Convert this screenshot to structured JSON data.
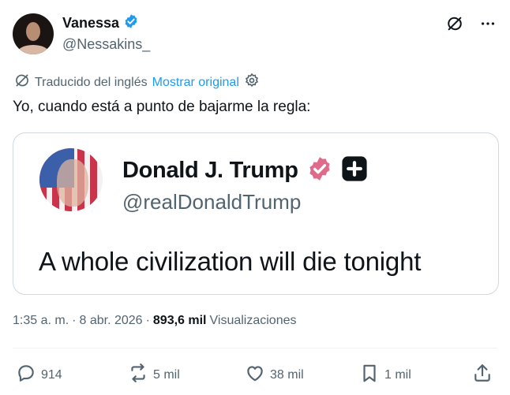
{
  "author": {
    "display_name": "Vanessa",
    "handle": "@Nessakins_",
    "verified": true
  },
  "header_actions": [
    "grok-icon",
    "more-icon"
  ],
  "translation": {
    "label": "Traducido del inglés",
    "link": "Mostrar original"
  },
  "tweet": {
    "text": "Yo, cuando está a punto de bajarme la regla:"
  },
  "media": {
    "name": "Donald J. Trump",
    "handle": "@realDonaldTrump",
    "text": "A whole civilization will die tonight"
  },
  "meta": {
    "time": "1:35 a. m.",
    "separator": "·",
    "date": "8 abr. 2026",
    "views": "893,6 mil",
    "views_label": "Visualizaciones"
  },
  "actions": {
    "replies": "914",
    "reposts": "5 mil",
    "likes": "38 mil",
    "bookmarks": "1 mil"
  },
  "colors": {
    "text": "#0f1419",
    "secondary": "#536471",
    "link": "#1d9bf0",
    "verified_blue": "#1d9bf0",
    "verified_pink": "#e06a8a",
    "border": "#cfd9de"
  }
}
